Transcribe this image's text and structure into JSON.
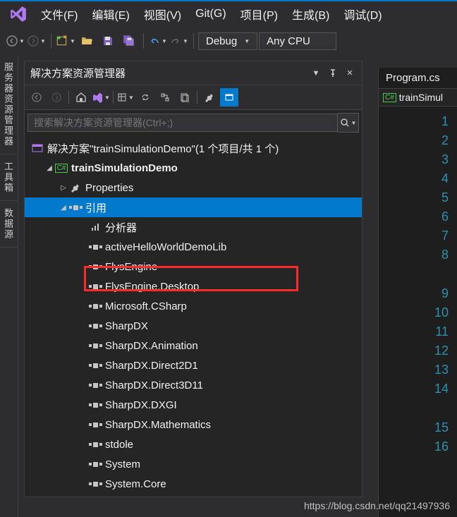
{
  "menu": {
    "file": "文件(F)",
    "edit": "编辑(E)",
    "view": "视图(V)",
    "git": "Git(G)",
    "project": "项目(P)",
    "build": "生成(B)",
    "debug": "调试(D)"
  },
  "toolbar": {
    "config": "Debug",
    "platform": "Any CPU"
  },
  "vtabs": {
    "server": "服务器资源管理器",
    "toolbox": "工具箱",
    "data": "数据源"
  },
  "panel": {
    "title": "解决方案资源管理器",
    "search_placeholder": "搜索解决方案资源管理器(Ctrl+;)"
  },
  "tree": {
    "solution": "解决方案\"trainSimulationDemo\"(1 个项目/共 1 个)",
    "project": "trainSimulationDemo",
    "properties": "Properties",
    "references": "引用",
    "analyzer": "分析器",
    "refs": [
      "activeHelloWorldDemoLib",
      "FlysEngine",
      "FlysEngine.Desktop",
      "Microsoft.CSharp",
      "SharpDX",
      "SharpDX.Animation",
      "SharpDX.Direct2D1",
      "SharpDX.Direct3D11",
      "SharpDX.DXGI",
      "SharpDX.Mathematics",
      "stdole",
      "System",
      "System.Core"
    ]
  },
  "editor": {
    "tab": "Program.cs",
    "subtab": "trainSimul",
    "lines": [
      "1",
      "2",
      "3",
      "4",
      "5",
      "6",
      "7",
      "8",
      "",
      "9",
      "10",
      "11",
      "12",
      "13",
      "14",
      "",
      "15",
      "16"
    ]
  },
  "watermark": "https://blog.csdn.net/qq21497936"
}
